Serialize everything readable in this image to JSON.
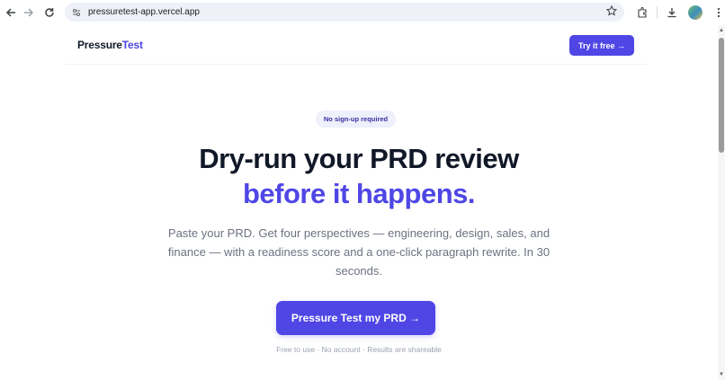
{
  "browser": {
    "url": "pressuretest-app.vercel.app",
    "icons": [
      "back-arrow-icon",
      "forward-arrow-icon",
      "reload-icon",
      "site-settings-icon",
      "bookmark-star-icon",
      "extensions-icon",
      "download-icon",
      "profile-avatar",
      "more-menu-icon"
    ]
  },
  "header": {
    "logo_part1": "Pressure",
    "logo_part2": "Test",
    "try_label": "Try it free →"
  },
  "hero": {
    "badge": "No sign-up required",
    "title_line1": "Dry-run your PRD review",
    "title_line2": "before it happens.",
    "subtitle": "Paste your PRD. Get four perspectives — engineering, design, sales, and finance — with a readiness score and a one-click paragraph rewrite. In 30 seconds.",
    "cta_label": "Pressure Test my PRD →",
    "footnote": "Free to use · No account · Results are shareable"
  },
  "colors": {
    "accent": "#4f46e5",
    "heading": "#111827",
    "muted": "#6b7280",
    "badge_bg": "#eef0fb"
  }
}
